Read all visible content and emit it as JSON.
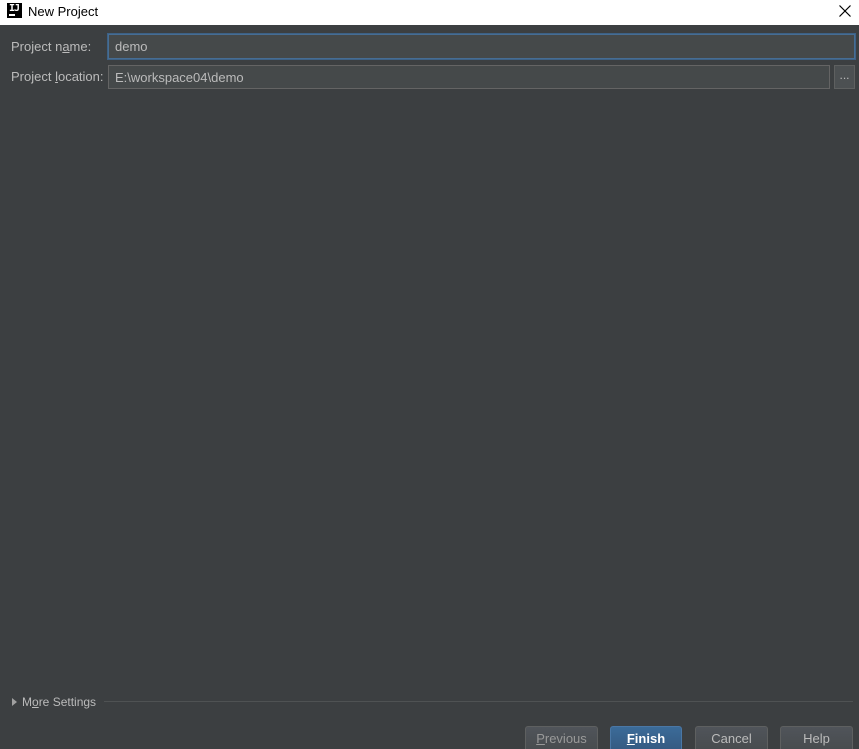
{
  "window": {
    "title": "New Project",
    "app_icon_glyph": "IJ",
    "close_icon": "close-icon"
  },
  "form": {
    "project_name": {
      "label_pre": "Project n",
      "label_mnemonic": "a",
      "label_post": "me:",
      "value": "demo"
    },
    "project_location": {
      "label_pre": "Project ",
      "label_mnemonic": "l",
      "label_post": "ocation:",
      "value": "E:\\workspace04\\demo",
      "browse_label": "..."
    }
  },
  "more_settings": {
    "label_pre": "M",
    "label_mnemonic": "o",
    "label_post": "re Settings",
    "expanded": false
  },
  "buttons": {
    "previous": {
      "mnemonic": "P",
      "rest": "revious",
      "enabled": false
    },
    "finish": {
      "mnemonic": "F",
      "rest": "inish",
      "default": true
    },
    "cancel": {
      "label": "Cancel"
    },
    "help": {
      "label": "Help"
    }
  },
  "colors": {
    "background": "#3c3f41",
    "titlebar": "#ffffff",
    "text": "#bbbbbb",
    "accent": "#3b6b99",
    "field_focus_border": "#466d94"
  }
}
